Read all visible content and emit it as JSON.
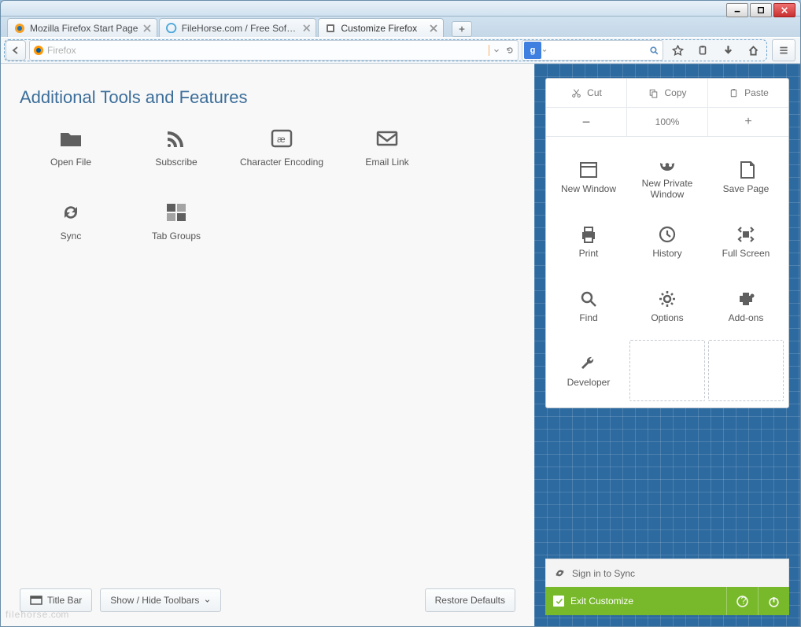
{
  "tabs": [
    {
      "label": "Mozilla Firefox Start Page",
      "icon": "firefox"
    },
    {
      "label": "FileHorse.com / Free Softw...",
      "icon": "filehorse"
    },
    {
      "label": "Customize Firefox",
      "icon": "customize",
      "active": true
    }
  ],
  "navbar": {
    "url_placeholder": "Firefox",
    "search_provider": "g"
  },
  "customize": {
    "heading": "Additional Tools and Features",
    "tools": [
      {
        "label": "Open File",
        "icon": "folder"
      },
      {
        "label": "Subscribe",
        "icon": "rss"
      },
      {
        "label": "Character Encoding",
        "icon": "encoding"
      },
      {
        "label": "Email Link",
        "icon": "mail"
      },
      {
        "label": "Sync",
        "icon": "sync"
      },
      {
        "label": "Tab Groups",
        "icon": "tabgroups"
      }
    ],
    "footer": {
      "title_bar": "Title Bar",
      "show_hide": "Show / Hide Toolbars",
      "restore": "Restore Defaults"
    }
  },
  "panel": {
    "edit": {
      "cut": "Cut",
      "copy": "Copy",
      "paste": "Paste"
    },
    "zoom": {
      "level": "100%"
    },
    "items": [
      {
        "label": "New Window",
        "icon": "window"
      },
      {
        "label": "New Private Window",
        "icon": "privmask"
      },
      {
        "label": "Save Page",
        "icon": "savepage"
      },
      {
        "label": "Print",
        "icon": "print"
      },
      {
        "label": "History",
        "icon": "history"
      },
      {
        "label": "Full Screen",
        "icon": "fullscreen"
      },
      {
        "label": "Find",
        "icon": "find"
      },
      {
        "label": "Options",
        "icon": "options"
      },
      {
        "label": "Add-ons",
        "icon": "addons"
      },
      {
        "label": "Developer",
        "icon": "wrench"
      }
    ],
    "sync_label": "Sign in to Sync",
    "exit_label": "Exit Customize"
  },
  "watermark": "filehorse",
  "watermark_suffix": ".com"
}
